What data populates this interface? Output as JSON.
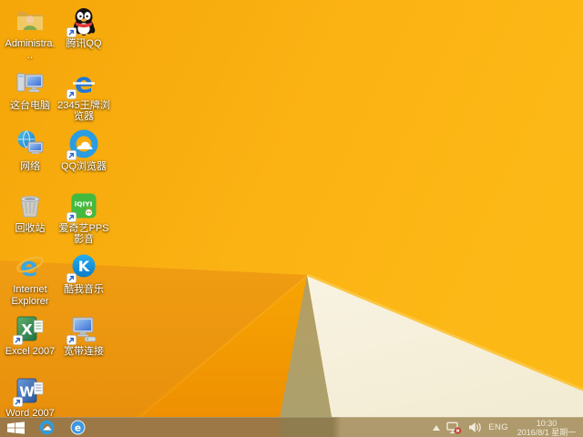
{
  "wallpaper": {
    "description": "Windows 8.1 orange geometric facet wallpaper",
    "colors": {
      "top_orange": "#FBB213",
      "left_orange": "#EC9410",
      "lower_orange": "#F29B02",
      "khaki_facet": "#B2A067",
      "cream_facet": "#F6F0DC",
      "edge_highlight": "#FBC53F",
      "taskbar_tint": "#9B7846"
    }
  },
  "desktop": {
    "icons": [
      {
        "id": "administrator-folder",
        "label": "Administra...",
        "icon": "user-folder",
        "shortcut": false,
        "col": 1,
        "row": 1
      },
      {
        "id": "tencent-qq",
        "label": "腾讯QQ",
        "icon": "qq-penguin",
        "shortcut": true,
        "col": 2,
        "row": 1
      },
      {
        "id": "this-pc",
        "label": "这台电脑",
        "icon": "computer",
        "shortcut": false,
        "col": 1,
        "row": 2
      },
      {
        "id": "2345-browser",
        "label": "2345王牌浏览器",
        "icon": "blue-e",
        "glyph": "e",
        "shortcut": true,
        "col": 2,
        "row": 2
      },
      {
        "id": "network",
        "label": "网络",
        "icon": "network-globe",
        "shortcut": false,
        "col": 1,
        "row": 3
      },
      {
        "id": "qq-browser",
        "label": "QQ浏览器",
        "icon": "qq-browser-ring",
        "shortcut": true,
        "col": 2,
        "row": 3
      },
      {
        "id": "recycle-bin",
        "label": "回收站",
        "icon": "recycle-bin",
        "shortcut": false,
        "col": 1,
        "row": 4
      },
      {
        "id": "iqiyi-pps",
        "label": "爱奇艺PPS 影音",
        "icon": "iqiyi",
        "glyph": "iQIYI",
        "shortcut": true,
        "col": 2,
        "row": 4
      },
      {
        "id": "internet-explorer",
        "label": "Internet Explorer",
        "icon": "ie",
        "glyph": "e",
        "shortcut": false,
        "col": 1,
        "row": 5
      },
      {
        "id": "kuwo-music",
        "label": "酷我音乐",
        "icon": "kuwo",
        "glyph": "K",
        "shortcut": true,
        "col": 2,
        "row": 5
      },
      {
        "id": "excel-2007",
        "label": "Excel 2007",
        "icon": "excel",
        "glyph": "X",
        "shortcut": true,
        "col": 1,
        "row": 6
      },
      {
        "id": "broadband-connection",
        "label": "宽带连接",
        "icon": "broadband",
        "shortcut": true,
        "col": 2,
        "row": 6
      },
      {
        "id": "word-2007",
        "label": "Word 2007",
        "icon": "word",
        "glyph": "W",
        "shortcut": true,
        "col": 1,
        "row": 7
      }
    ]
  },
  "taskbar": {
    "start": {
      "id": "start",
      "icon": "windows-logo"
    },
    "pinned": [
      {
        "id": "qq-browser",
        "icon": "qq-browser-ring"
      },
      {
        "id": "2345-browser",
        "icon": "e-badge",
        "glyph": "e"
      }
    ],
    "tray": {
      "language": "ENG",
      "time": "10:30",
      "date": "2016/8/1 星期一"
    }
  }
}
